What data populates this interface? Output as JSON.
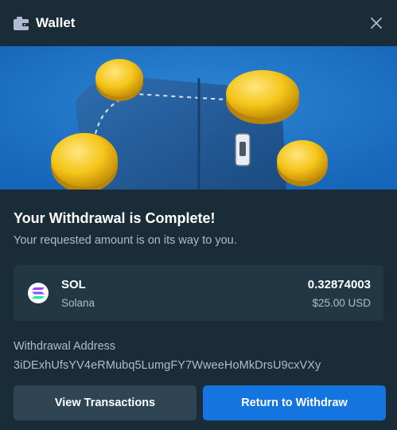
{
  "header": {
    "title": "Wallet",
    "icon": "wallet-icon",
    "close_icon": "close-icon"
  },
  "banner": {
    "image": "wallet-with-gold-coins-illustration"
  },
  "status": {
    "heading": "Your Withdrawal is Complete!",
    "subheading": "Your requested amount is on its way to you."
  },
  "asset": {
    "icon": "solana-icon",
    "symbol": "SOL",
    "network": "Solana",
    "amount": "0.32874003",
    "usd_value": "$25.00 USD"
  },
  "withdrawal": {
    "address_label": "Withdrawal Address",
    "address": "3iDExhUfsYV4eRMubq5LumgFY7WweeHoMkDrsU9cxVXy"
  },
  "actions": {
    "view_transactions": "View Transactions",
    "return_to_withdraw": "Return to Withdraw"
  },
  "colors": {
    "background": "#1a2c38",
    "card": "#213743",
    "secondary_button": "#2f4553",
    "primary_button": "#1475e1",
    "muted_text": "#b1bad3"
  }
}
